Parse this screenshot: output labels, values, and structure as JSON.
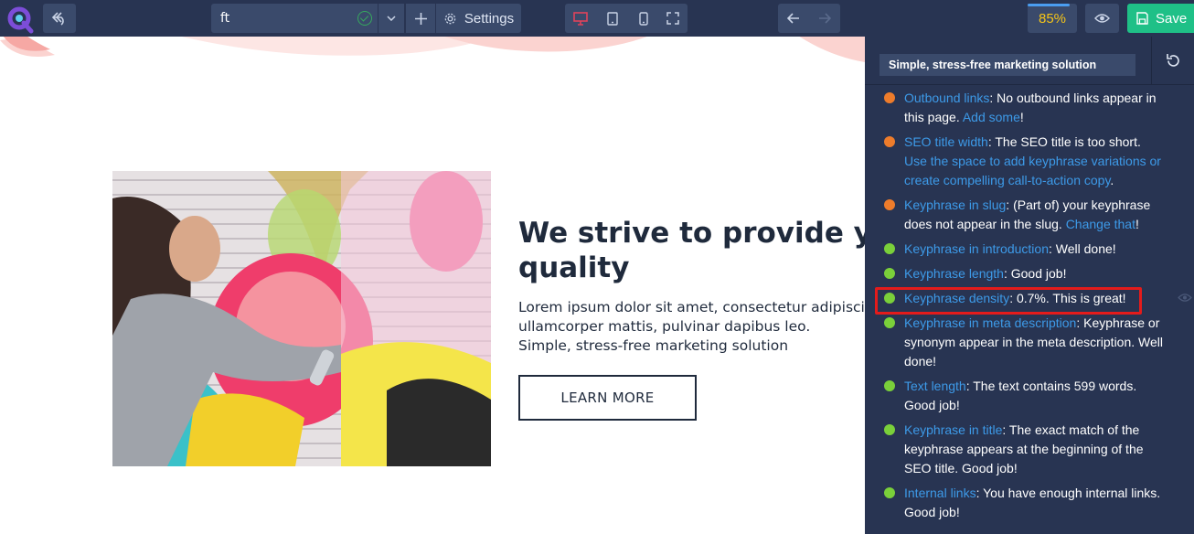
{
  "toolbar": {
    "page_title_value": "ft",
    "settings_label": "Settings",
    "seo_score": "85%",
    "save_label": "Save",
    "colors": {
      "toolbar_bg": "#283452",
      "button_bg": "#3a4a6b",
      "save_green": "#1fc087",
      "score_yellow": "#f5c518",
      "active_device": "#e0435b"
    },
    "icons": [
      "logo-icon",
      "undo-history-icon",
      "check-circle-icon",
      "chevron-down-icon",
      "plus-icon",
      "gear-icon",
      "desktop-icon",
      "tablet-icon",
      "mobile-icon",
      "fullscreen-icon",
      "arrow-left-icon",
      "arrow-right-icon",
      "eye-icon",
      "save-icon"
    ]
  },
  "canvas": {
    "headline": "We strive to provide you quality",
    "headline_line1": "We strive to provide you",
    "headline_line2": "quality",
    "body_line1": "Lorem ipsum dolor sit amet, consectetur adipiscing",
    "body_line2": "ullamcorper mattis, pulvinar dapibus leo.",
    "body_line3": "Simple, stress-free marketing solution",
    "button_label": "LEARN MORE"
  },
  "seo_panel": {
    "focus_keyphrase": "Simple, stress-free marketing solution",
    "colors": {
      "orange": "#ee7c2b",
      "green": "#7ad03a",
      "link": "#3d9ae8",
      "highlight": "#e41b1b"
    },
    "results": [
      {
        "status": "orange",
        "parts": [
          [
            "link",
            "Outbound links"
          ],
          [
            "text",
            ": No outbound links appear in this page. "
          ],
          [
            "link",
            "Add some"
          ],
          [
            "text",
            "!"
          ]
        ]
      },
      {
        "status": "orange",
        "parts": [
          [
            "link",
            "SEO title width"
          ],
          [
            "text",
            ": The SEO title is too short. "
          ],
          [
            "link",
            "Use the space to add keyphrase variations or create compelling call-to-action copy"
          ],
          [
            "text",
            "."
          ]
        ]
      },
      {
        "status": "orange",
        "parts": [
          [
            "link",
            "Keyphrase in slug"
          ],
          [
            "text",
            ": (Part of) your keyphrase does not appear in the slug. "
          ],
          [
            "link",
            "Change that"
          ],
          [
            "text",
            "!"
          ]
        ]
      },
      {
        "status": "green",
        "parts": [
          [
            "link",
            "Keyphrase in introduction"
          ],
          [
            "text",
            ": Well done!"
          ]
        ]
      },
      {
        "status": "green",
        "parts": [
          [
            "link",
            "Keyphrase length"
          ],
          [
            "text",
            ": Good job!"
          ]
        ]
      },
      {
        "status": "green",
        "parts": [
          [
            "link",
            "Keyphrase density"
          ],
          [
            "text",
            ": 0.7%. This is great!"
          ]
        ]
      },
      {
        "status": "green",
        "parts": [
          [
            "link",
            "Keyphrase in meta description"
          ],
          [
            "text",
            ": Keyphrase or synonym appear in the meta description. Well done!"
          ]
        ]
      },
      {
        "status": "green",
        "parts": [
          [
            "link",
            "Text length"
          ],
          [
            "text",
            ": The text contains 599 words. Good job!"
          ]
        ]
      },
      {
        "status": "green",
        "parts": [
          [
            "link",
            "Keyphrase in title"
          ],
          [
            "text",
            ": The exact match of the keyphrase appears at the beginning of the SEO title. Good job!"
          ]
        ]
      },
      {
        "status": "green",
        "parts": [
          [
            "link",
            "Internal links"
          ],
          [
            "text",
            ": You have enough internal links. Good job!"
          ]
        ]
      }
    ]
  }
}
